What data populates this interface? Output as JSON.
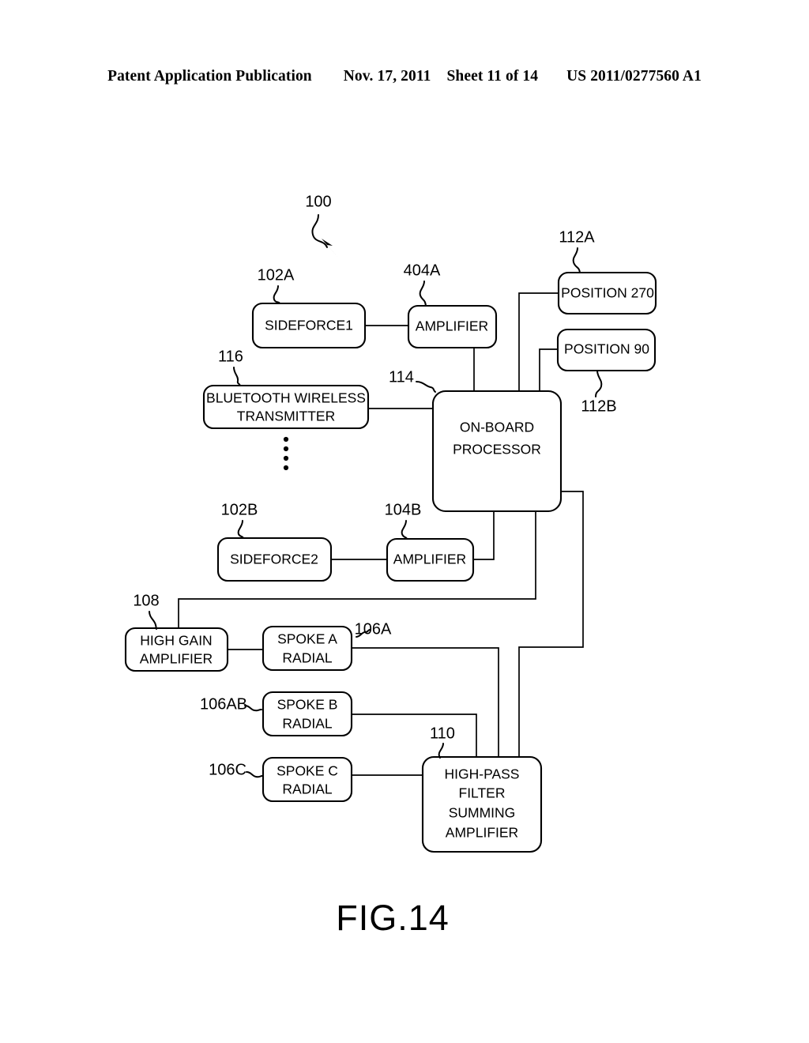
{
  "header": {
    "publication": "Patent Application Publication",
    "date": "Nov. 17, 2011",
    "sheet": "Sheet 11 of 14",
    "docket": "US 2011/0277560 A1"
  },
  "figure": {
    "caption": "FIG.14",
    "system_ref": "100",
    "blocks": [
      {
        "id": "sideforce1",
        "ref": "102A",
        "lines": [
          "SIDEFORCE1"
        ]
      },
      {
        "id": "amplifier_a",
        "ref": "404A",
        "lines": [
          "AMPLIFIER"
        ]
      },
      {
        "id": "position270",
        "ref": "112A",
        "lines": [
          "POSITION 270"
        ]
      },
      {
        "id": "position90",
        "ref": "112B",
        "lines": [
          "POSITION 90"
        ]
      },
      {
        "id": "bluetooth",
        "ref": "116",
        "lines": [
          "BLUETOOTH WIRELESS",
          "TRANSMITTER"
        ]
      },
      {
        "id": "processor",
        "ref": "114",
        "lines": [
          "ON-BOARD",
          "PROCESSOR"
        ]
      },
      {
        "id": "sideforce2",
        "ref": "102B",
        "lines": [
          "SIDEFORCE2"
        ]
      },
      {
        "id": "amplifier_b",
        "ref": "104B",
        "lines": [
          "AMPLIFIER"
        ]
      },
      {
        "id": "high_gain_amplifier",
        "ref": "108",
        "lines": [
          "HIGH GAIN",
          "AMPLIFIER"
        ]
      },
      {
        "id": "spoke_a",
        "ref": "106A",
        "lines": [
          "SPOKE A",
          "RADIAL"
        ]
      },
      {
        "id": "spoke_b",
        "ref": "106AB",
        "lines": [
          "SPOKE B",
          "RADIAL"
        ]
      },
      {
        "id": "spoke_c",
        "ref": "106C",
        "lines": [
          "SPOKE C",
          "RADIAL"
        ]
      },
      {
        "id": "high_pass_filter",
        "ref": "110",
        "lines": [
          "HIGH-PASS",
          "FILTER",
          "SUMMING",
          "AMPLIFIER"
        ]
      }
    ],
    "ellipsis_note": "vertical-ellipsis-under-bluetooth"
  }
}
